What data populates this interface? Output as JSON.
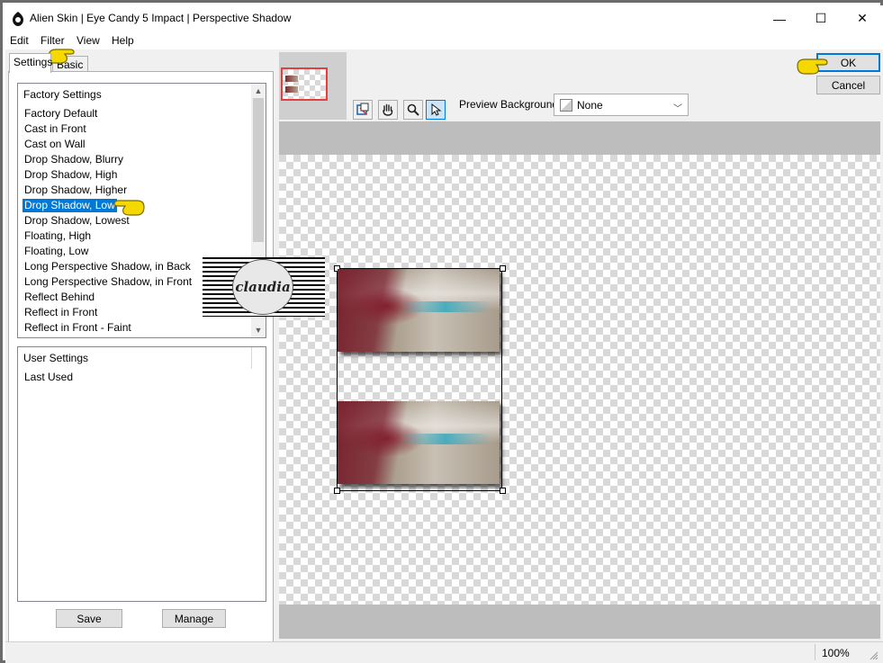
{
  "window": {
    "title": "Alien Skin | Eye Candy 5 Impact | Perspective Shadow",
    "minimize": "—",
    "maximize": "☐",
    "close": "✕"
  },
  "menu": {
    "edit": "Edit",
    "filter": "Filter",
    "view": "View",
    "help": "Help"
  },
  "tabs": {
    "settings": "Settings",
    "basic": "Basic"
  },
  "factory": {
    "header": "Factory Settings",
    "items": [
      "Factory Default",
      "Cast in Front",
      "Cast on Wall",
      "Drop Shadow, Blurry",
      "Drop Shadow, High",
      "Drop Shadow, Higher",
      "Drop Shadow, Low",
      "Drop Shadow, Lowest",
      "Floating, High",
      "Floating, Low",
      "Long Perspective Shadow, in Back",
      "Long Perspective Shadow, in Front",
      "Reflect Behind",
      "Reflect in Front",
      "Reflect in Front - Faint"
    ],
    "selected_index": 6
  },
  "user": {
    "header": "User Settings",
    "items": [
      "Last Used"
    ]
  },
  "buttons": {
    "save": "Save",
    "manage": "Manage",
    "ok": "OK",
    "cancel": "Cancel"
  },
  "preview_bg": {
    "label": "Preview Background:",
    "value": "None"
  },
  "watermark": {
    "text": "claudia"
  },
  "status": {
    "zoom": "100%"
  },
  "colors": {
    "accent": "#0078d7",
    "pointer": "#f5d800"
  }
}
